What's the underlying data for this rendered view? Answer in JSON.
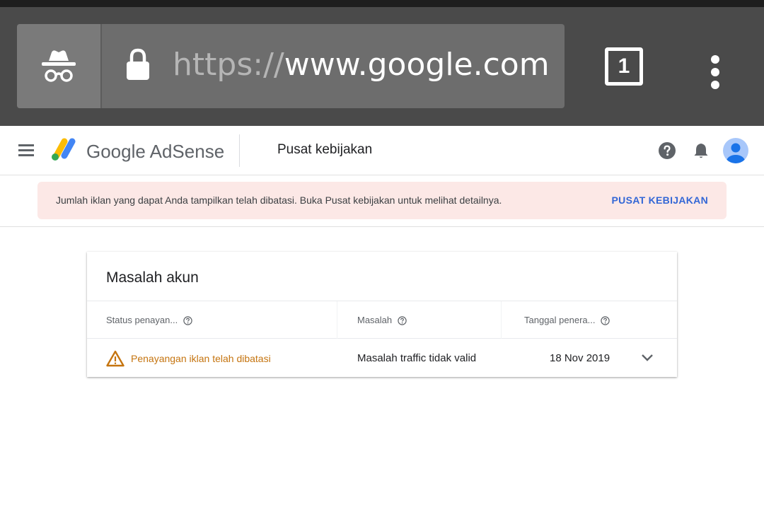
{
  "browser": {
    "url_scheme": "https://",
    "url_host": "www.google.com/",
    "tab_count": "1",
    "icons": {
      "incognito": "incognito-icon",
      "lock": "lock-icon",
      "tabs": "tab-switcher-icon",
      "menu": "more-vert-icon"
    },
    "colors": {
      "chrome_bg": "#4a4a4a",
      "omnibox_bg": "#6d6d6d"
    }
  },
  "header": {
    "logo_text": "Google AdSense",
    "page_title": "Pusat kebijakan",
    "icons": {
      "menu": "hamburger-menu-icon",
      "help": "help-icon",
      "notifications": "bell-icon",
      "account": "avatar"
    }
  },
  "banner": {
    "message": "Jumlah iklan yang dapat Anda tampilkan telah dibatasi. Buka Pusat kebijakan untuk melihat detailnya.",
    "action_label": "PUSAT KEBIJAKAN",
    "colors": {
      "background": "#fce8e6",
      "action": "#3367d6"
    }
  },
  "card": {
    "title": "Masalah akun",
    "columns": [
      {
        "label": "Status penayan..."
      },
      {
        "label": "Masalah"
      },
      {
        "label": "Tanggal penera..."
      }
    ],
    "rows": [
      {
        "status": "Penayangan iklan telah dibatasi",
        "issue": "Masalah traffic tidak valid",
        "date": "18 Nov 2019",
        "status_icon": "warning-icon",
        "status_color": "#c5740f"
      }
    ]
  }
}
